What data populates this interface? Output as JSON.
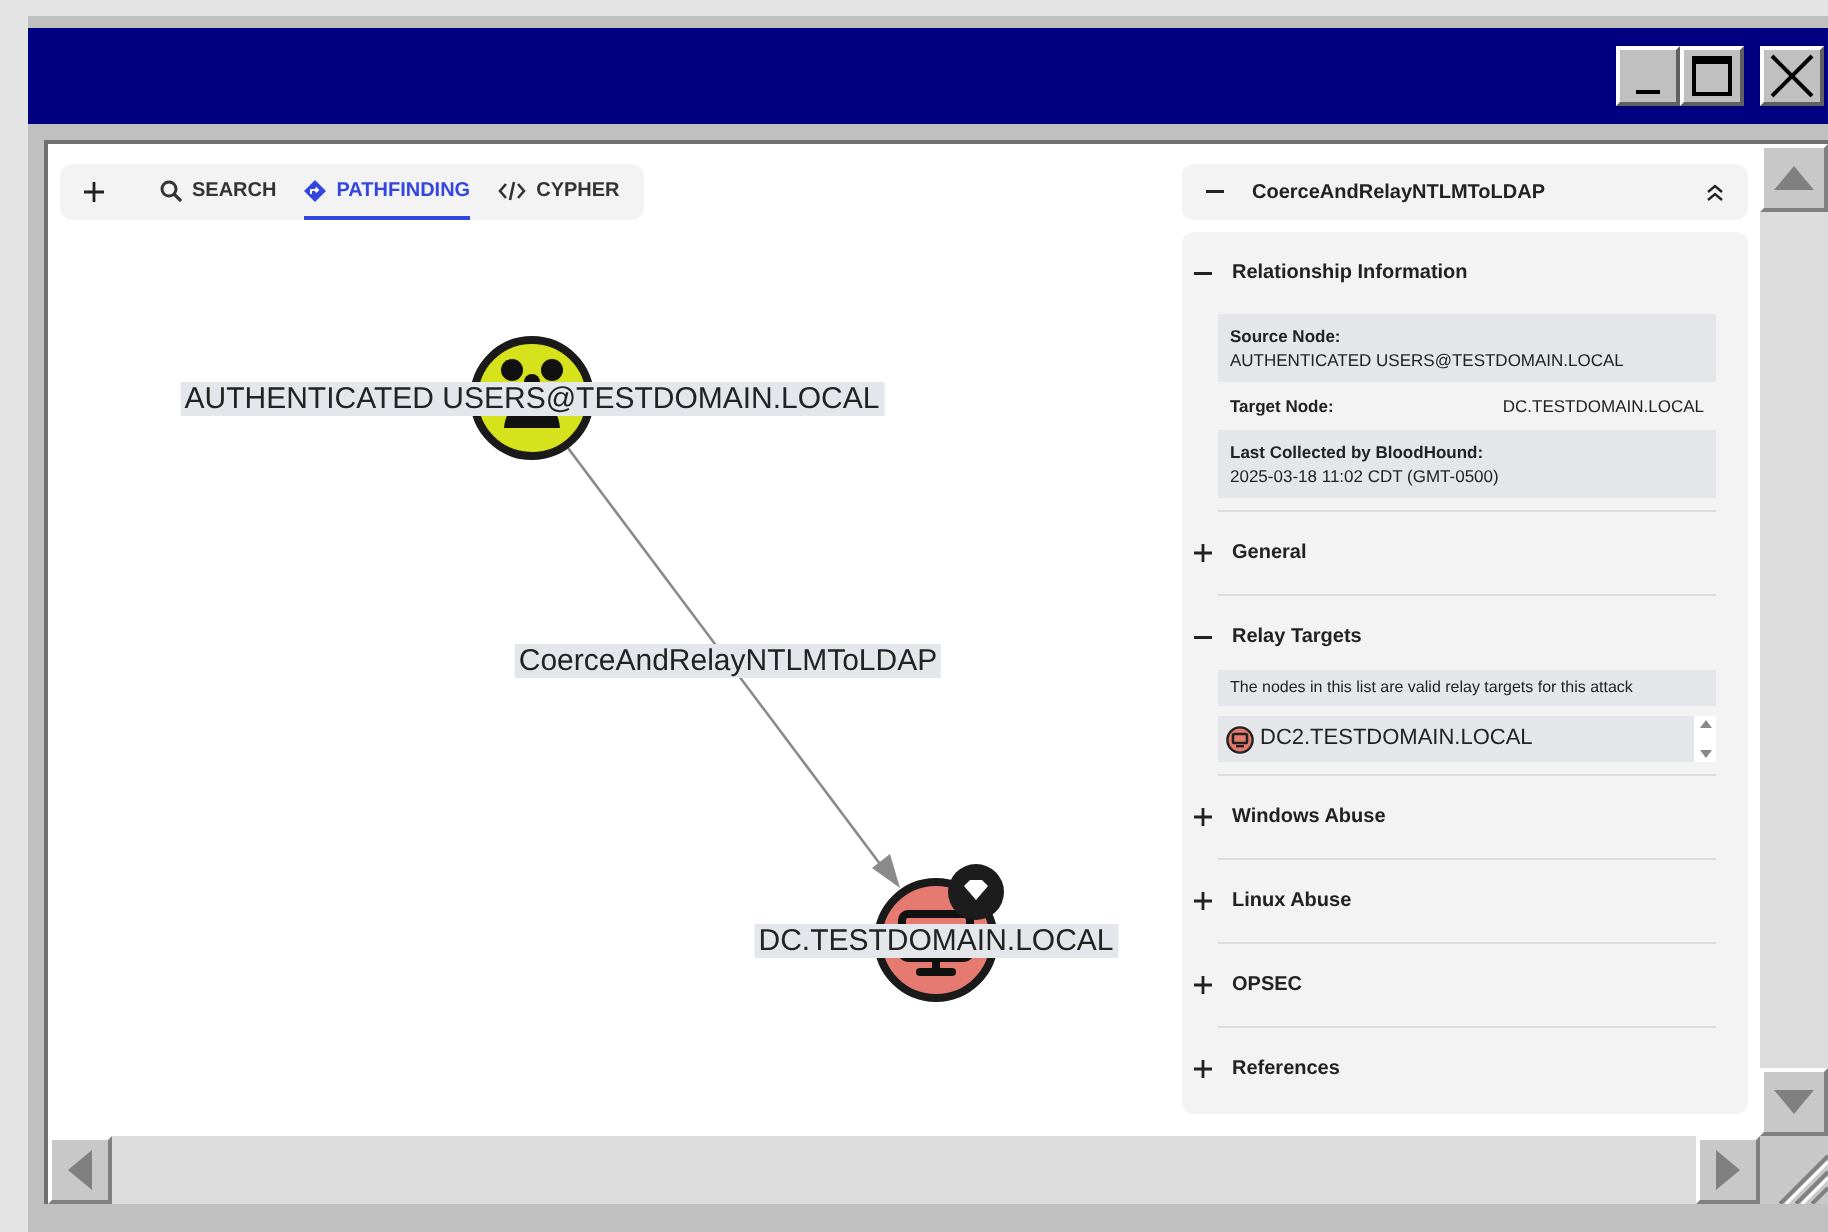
{
  "toolbar": {
    "tabs": [
      {
        "label": "SEARCH",
        "kind": "search",
        "selected": false
      },
      {
        "label": "PATHFINDING",
        "kind": "pathfinding",
        "selected": true
      },
      {
        "label": "CYPHER",
        "kind": "cypher",
        "selected": false
      }
    ]
  },
  "graph": {
    "nodes": [
      {
        "label": "AUTHENTICATED USERS@TESTDOMAIN.LOCAL",
        "kind": "group",
        "color": "#d6e21c",
        "tier_zero": false
      },
      {
        "label": "DC.TESTDOMAIN.LOCAL",
        "kind": "computer",
        "color": "#e57b70",
        "tier_zero": true
      }
    ],
    "edge": {
      "label": "CoerceAndRelayNTLMToLDAP"
    }
  },
  "panel": {
    "title": "CoerceAndRelayNTLMToLDAP",
    "expanded": true,
    "sections": [
      {
        "title": "Relationship Information",
        "expanded": true,
        "fields": [
          {
            "kind": "stacked",
            "label": "Source Node:",
            "value": "AUTHENTICATED USERS@TESTDOMAIN.LOCAL"
          },
          {
            "kind": "inline",
            "label": "Target Node:",
            "value": "DC.TESTDOMAIN.LOCAL"
          },
          {
            "kind": "stacked",
            "label": "Last Collected by BloodHound:",
            "value": "2025-03-18 11:02 CDT (GMT-0500)"
          }
        ]
      },
      {
        "title": "General",
        "expanded": false
      },
      {
        "title": "Relay Targets",
        "expanded": true,
        "note": "The nodes in this list are valid relay targets for this attack",
        "targets": [
          {
            "label": "DC2.TESTDOMAIN.LOCAL",
            "kind": "computer"
          }
        ]
      },
      {
        "title": "Windows Abuse",
        "expanded": false
      },
      {
        "title": "Linux Abuse",
        "expanded": false
      },
      {
        "title": "OPSEC",
        "expanded": false
      },
      {
        "title": "References",
        "expanded": false
      }
    ]
  }
}
